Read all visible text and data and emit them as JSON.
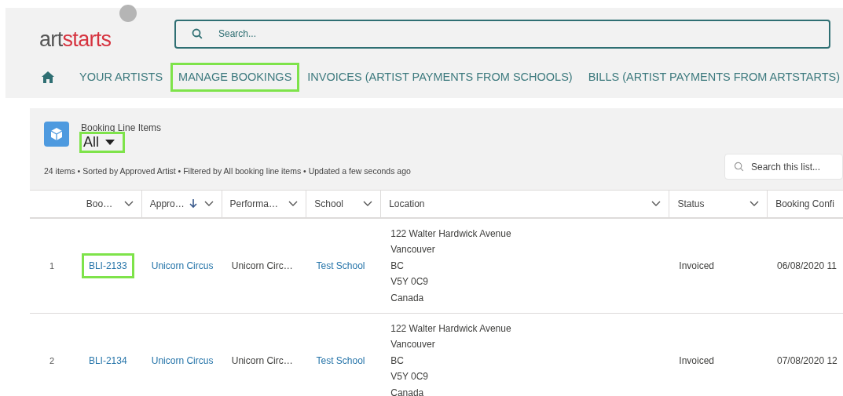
{
  "logo": {
    "part_1": "art",
    "part_2": "starts"
  },
  "search": {
    "placeholder": "Search..."
  },
  "nav": {
    "items": [
      {
        "kind": "home",
        "highlighted": false
      },
      {
        "kind": "tab",
        "label": "YOUR ARTISTS",
        "highlighted": false
      },
      {
        "kind": "tab",
        "label": "MANAGE BOOKINGS",
        "highlighted": true
      },
      {
        "kind": "tab",
        "label": "INVOICES (ARTIST PAYMENTS FROM SCHOOLS)",
        "highlighted": false
      },
      {
        "kind": "tab",
        "label": "BILLS (ARTIST PAYMENTS FROM ARTSTARTS)",
        "highlighted": false
      }
    ]
  },
  "list_view": {
    "object_label": "Booking Line Items",
    "view": {
      "label": "All",
      "highlighted": true
    },
    "summary": "24 items • Sorted by Approved Artist • Filtered by All booking line items • Updated a few seconds ago",
    "search": {
      "placeholder": "Search this list..."
    }
  },
  "table": {
    "columns": [
      {
        "label": "Boo…",
        "sorted_descending": false,
        "menu": true
      },
      {
        "label": "Appro…",
        "sorted_descending": true,
        "menu": true
      },
      {
        "label": "Performa…",
        "sorted_descending": false,
        "menu": true
      },
      {
        "label": "School",
        "sorted_descending": false,
        "menu": true
      },
      {
        "label": "Location",
        "sorted_descending": false,
        "menu": true
      },
      {
        "label": "Status",
        "sorted_descending": false,
        "menu": true
      },
      {
        "label": "Booking Confi",
        "sorted_descending": false,
        "menu": false
      }
    ],
    "rows": [
      {
        "number": "1",
        "cells": [
          {
            "kind": "link",
            "text": "BLI-2133",
            "highlighted": true
          },
          {
            "kind": "link",
            "text": "Unicorn Circus",
            "highlighted": false
          },
          {
            "kind": "text",
            "text": "Unicorn Circ…",
            "highlighted": false
          },
          {
            "kind": "link",
            "text": "Test School",
            "highlighted": false
          },
          {
            "kind": "address",
            "lines": [
              "122 Walter Hardwick Avenue",
              "Vancouver",
              "BC",
              "V5Y 0C9",
              "Canada"
            ],
            "highlighted": false
          },
          {
            "kind": "text",
            "text": "Invoiced",
            "highlighted": false
          },
          {
            "kind": "text",
            "text": "06/08/2020 11",
            "highlighted": false
          }
        ]
      },
      {
        "number": "2",
        "cells": [
          {
            "kind": "link",
            "text": "BLI-2134",
            "highlighted": false
          },
          {
            "kind": "link",
            "text": "Unicorn Circus",
            "highlighted": false
          },
          {
            "kind": "text",
            "text": "Unicorn Circ…",
            "highlighted": false
          },
          {
            "kind": "link",
            "text": "Test School",
            "highlighted": false
          },
          {
            "kind": "address",
            "lines": [
              "122 Walter Hardwick Avenue",
              "Vancouver",
              "BC",
              "V5Y 0C9",
              "Canada"
            ],
            "highlighted": false
          },
          {
            "kind": "text",
            "text": "Invoiced",
            "highlighted": false
          },
          {
            "kind": "text",
            "text": "07/08/2020 12",
            "highlighted": false
          }
        ]
      }
    ]
  }
}
